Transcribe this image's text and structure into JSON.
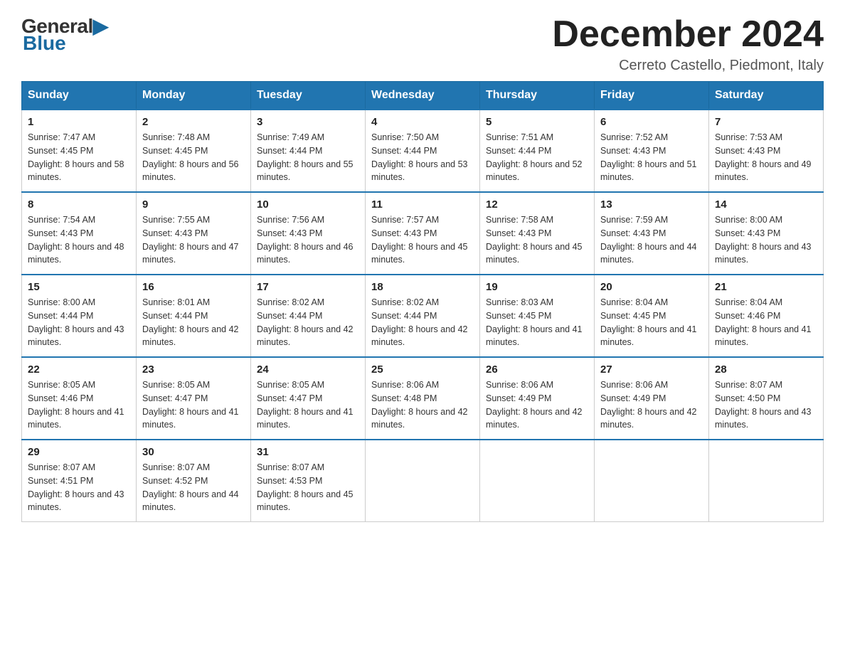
{
  "logo": {
    "general": "General",
    "blue": "Blue",
    "triangle": "▶"
  },
  "title": "December 2024",
  "location": "Cerreto Castello, Piedmont, Italy",
  "days_of_week": [
    "Sunday",
    "Monday",
    "Tuesday",
    "Wednesday",
    "Thursday",
    "Friday",
    "Saturday"
  ],
  "weeks": [
    [
      {
        "day": "1",
        "sunrise": "7:47 AM",
        "sunset": "4:45 PM",
        "daylight": "8 hours and 58 minutes."
      },
      {
        "day": "2",
        "sunrise": "7:48 AM",
        "sunset": "4:45 PM",
        "daylight": "8 hours and 56 minutes."
      },
      {
        "day": "3",
        "sunrise": "7:49 AM",
        "sunset": "4:44 PM",
        "daylight": "8 hours and 55 minutes."
      },
      {
        "day": "4",
        "sunrise": "7:50 AM",
        "sunset": "4:44 PM",
        "daylight": "8 hours and 53 minutes."
      },
      {
        "day": "5",
        "sunrise": "7:51 AM",
        "sunset": "4:44 PM",
        "daylight": "8 hours and 52 minutes."
      },
      {
        "day": "6",
        "sunrise": "7:52 AM",
        "sunset": "4:43 PM",
        "daylight": "8 hours and 51 minutes."
      },
      {
        "day": "7",
        "sunrise": "7:53 AM",
        "sunset": "4:43 PM",
        "daylight": "8 hours and 49 minutes."
      }
    ],
    [
      {
        "day": "8",
        "sunrise": "7:54 AM",
        "sunset": "4:43 PM",
        "daylight": "8 hours and 48 minutes."
      },
      {
        "day": "9",
        "sunrise": "7:55 AM",
        "sunset": "4:43 PM",
        "daylight": "8 hours and 47 minutes."
      },
      {
        "day": "10",
        "sunrise": "7:56 AM",
        "sunset": "4:43 PM",
        "daylight": "8 hours and 46 minutes."
      },
      {
        "day": "11",
        "sunrise": "7:57 AM",
        "sunset": "4:43 PM",
        "daylight": "8 hours and 45 minutes."
      },
      {
        "day": "12",
        "sunrise": "7:58 AM",
        "sunset": "4:43 PM",
        "daylight": "8 hours and 45 minutes."
      },
      {
        "day": "13",
        "sunrise": "7:59 AM",
        "sunset": "4:43 PM",
        "daylight": "8 hours and 44 minutes."
      },
      {
        "day": "14",
        "sunrise": "8:00 AM",
        "sunset": "4:43 PM",
        "daylight": "8 hours and 43 minutes."
      }
    ],
    [
      {
        "day": "15",
        "sunrise": "8:00 AM",
        "sunset": "4:44 PM",
        "daylight": "8 hours and 43 minutes."
      },
      {
        "day": "16",
        "sunrise": "8:01 AM",
        "sunset": "4:44 PM",
        "daylight": "8 hours and 42 minutes."
      },
      {
        "day": "17",
        "sunrise": "8:02 AM",
        "sunset": "4:44 PM",
        "daylight": "8 hours and 42 minutes."
      },
      {
        "day": "18",
        "sunrise": "8:02 AM",
        "sunset": "4:44 PM",
        "daylight": "8 hours and 42 minutes."
      },
      {
        "day": "19",
        "sunrise": "8:03 AM",
        "sunset": "4:45 PM",
        "daylight": "8 hours and 41 minutes."
      },
      {
        "day": "20",
        "sunrise": "8:04 AM",
        "sunset": "4:45 PM",
        "daylight": "8 hours and 41 minutes."
      },
      {
        "day": "21",
        "sunrise": "8:04 AM",
        "sunset": "4:46 PM",
        "daylight": "8 hours and 41 minutes."
      }
    ],
    [
      {
        "day": "22",
        "sunrise": "8:05 AM",
        "sunset": "4:46 PM",
        "daylight": "8 hours and 41 minutes."
      },
      {
        "day": "23",
        "sunrise": "8:05 AM",
        "sunset": "4:47 PM",
        "daylight": "8 hours and 41 minutes."
      },
      {
        "day": "24",
        "sunrise": "8:05 AM",
        "sunset": "4:47 PM",
        "daylight": "8 hours and 41 minutes."
      },
      {
        "day": "25",
        "sunrise": "8:06 AM",
        "sunset": "4:48 PM",
        "daylight": "8 hours and 42 minutes."
      },
      {
        "day": "26",
        "sunrise": "8:06 AM",
        "sunset": "4:49 PM",
        "daylight": "8 hours and 42 minutes."
      },
      {
        "day": "27",
        "sunrise": "8:06 AM",
        "sunset": "4:49 PM",
        "daylight": "8 hours and 42 minutes."
      },
      {
        "day": "28",
        "sunrise": "8:07 AM",
        "sunset": "4:50 PM",
        "daylight": "8 hours and 43 minutes."
      }
    ],
    [
      {
        "day": "29",
        "sunrise": "8:07 AM",
        "sunset": "4:51 PM",
        "daylight": "8 hours and 43 minutes."
      },
      {
        "day": "30",
        "sunrise": "8:07 AM",
        "sunset": "4:52 PM",
        "daylight": "8 hours and 44 minutes."
      },
      {
        "day": "31",
        "sunrise": "8:07 AM",
        "sunset": "4:53 PM",
        "daylight": "8 hours and 45 minutes."
      },
      null,
      null,
      null,
      null
    ]
  ]
}
